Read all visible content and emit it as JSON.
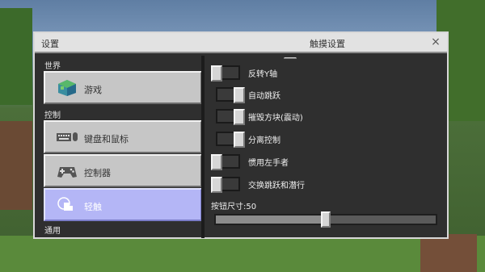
{
  "dialog": {
    "title_left": "设置",
    "title_center": "触摸设置",
    "close_glyph": "×"
  },
  "sidebar": {
    "sections": [
      {
        "label": "世界"
      },
      {
        "label": "控制"
      },
      {
        "label": "通用"
      }
    ],
    "items": [
      {
        "label": "游戏",
        "icon": "world-cube-icon",
        "selected": false
      },
      {
        "label": "键盘和鼠标",
        "icon": "keyboard-mouse-icon",
        "selected": false
      },
      {
        "label": "控制器",
        "icon": "gamepad-icon",
        "selected": false
      },
      {
        "label": "轻触",
        "icon": "touch-hand-icon",
        "selected": true
      }
    ]
  },
  "touch_settings": {
    "options": [
      {
        "label": "反转Y轴",
        "enabled": false
      },
      {
        "label": "自动跳跃",
        "enabled": true
      },
      {
        "label": "摧毁方块(震动)",
        "enabled": true
      },
      {
        "label": "分离控制",
        "enabled": true
      },
      {
        "label": "惯用左手者",
        "enabled": false
      },
      {
        "label": "交换跳跃和潜行",
        "enabled": false
      }
    ],
    "button_size_label": "按钮尺寸:50",
    "button_size_value": 50
  },
  "colors": {
    "selected_tab": "#b4b6f6",
    "panel_bg": "#2f2f2f"
  }
}
